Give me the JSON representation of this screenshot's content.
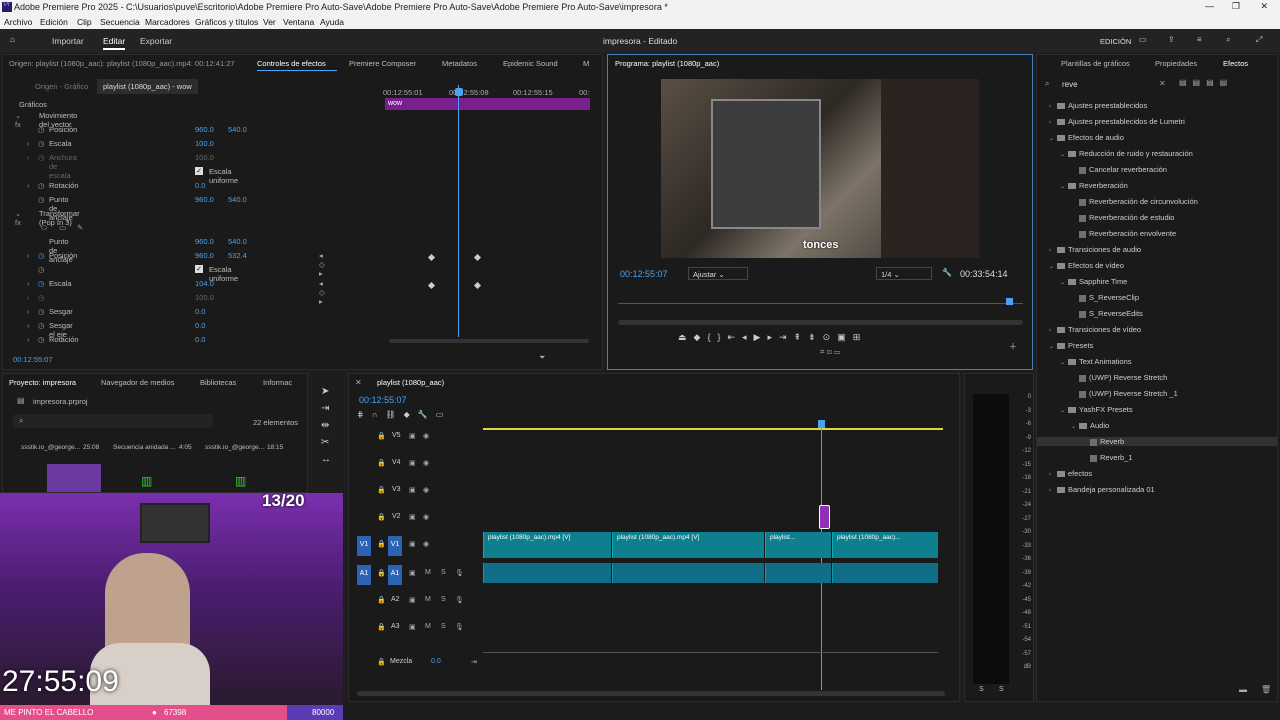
{
  "window": {
    "title": "Adobe Premiere Pro 2025 - C:\\Usuarios\\puve\\Escritorio\\Adobe Premiere Pro Auto-Save\\Adobe Premiere Pro Auto-Save\\Adobe Premiere Pro Auto-Save\\impresora *"
  },
  "menu": [
    "Archivo",
    "Edición",
    "Clip",
    "Secuencia",
    "Marcadores",
    "Gráficos y títulos",
    "Ver",
    "Ventana",
    "Ayuda"
  ],
  "workspace": {
    "import": "Importar",
    "edit": "Editar",
    "export": "Exportar",
    "project_status": "impresora - Editado",
    "mode": "EDICIÓN"
  },
  "effect_controls": {
    "header": "Origen: playlist (1080p_aac): playlist (1080p_aac).mp4: 00:12:41:27",
    "tabs": [
      "Controles de efectos",
      "Premiere Composer",
      "Metadatos",
      "Epidemic Sound",
      "M"
    ],
    "source_tab": "Origen - Gráfico",
    "clip_tab": "playlist (1080p_aac) - wow",
    "times": [
      "00:12:55:01",
      "00:12:55:08",
      "00:12:55:15",
      "00:"
    ],
    "clip_label": "wow",
    "section": "Gráficos",
    "props": [
      {
        "label": "Movimiento del vector",
        "v1": "",
        "v2": ""
      },
      {
        "label": "Posición",
        "v1": "960.0",
        "v2": "540.0"
      },
      {
        "label": "Escala",
        "v1": "100.0",
        "v2": ""
      },
      {
        "label": "Anchura de escala",
        "v1": "100.0",
        "v2": ""
      },
      {
        "label": "Escala uniforme",
        "v1": "",
        "v2": ""
      },
      {
        "label": "Rotación",
        "v1": "0.0",
        "v2": ""
      },
      {
        "label": "Punto de anclaje",
        "v1": "960.0",
        "v2": "540.0"
      },
      {
        "label": "Transformar (Pop In 3)",
        "v1": "",
        "v2": ""
      },
      {
        "label": "",
        "v1": "",
        "v2": ""
      },
      {
        "label": "Punto de anclaje",
        "v1": "960.0",
        "v2": "540.0"
      },
      {
        "label": "Posición",
        "v1": "960.0",
        "v2": "532.4"
      },
      {
        "label": "Escala uniforme",
        "v1": "",
        "v2": ""
      },
      {
        "label": "Escala",
        "v1": "104.0",
        "v2": ""
      },
      {
        "label": "",
        "v1": "100.0",
        "v2": ""
      },
      {
        "label": "Sesgar",
        "v1": "0.0",
        "v2": ""
      },
      {
        "label": "Sesgar el eje",
        "v1": "0.0",
        "v2": ""
      },
      {
        "label": "Rotación",
        "v1": "0.0",
        "v2": ""
      }
    ],
    "timecode": "00:12:55:07"
  },
  "program": {
    "title": "Programa: playlist (1080p_aac)",
    "timecode": "00:12:55:07",
    "fit": "Ajustar",
    "quality": "1/4",
    "duration": "00:33:54:14",
    "caption": "tonces"
  },
  "effects": {
    "tabs": [
      "Plantillas de gráficos",
      "Propiedades",
      "Efectos"
    ],
    "search": "reve",
    "tree": [
      {
        "d": 0,
        "t": "Ajustes preestablecidos",
        "o": false
      },
      {
        "d": 0,
        "t": "Ajustes preestablecidos de Lumetri",
        "o": false
      },
      {
        "d": 0,
        "t": "Efectos de audio",
        "o": true
      },
      {
        "d": 1,
        "t": "Reducción de ruido y restauración",
        "o": true
      },
      {
        "d": 2,
        "t": "Cancelar reverberación",
        "o": null
      },
      {
        "d": 1,
        "t": "Reverberación",
        "o": true
      },
      {
        "d": 2,
        "t": "Reverberación de circunvolución",
        "o": null
      },
      {
        "d": 2,
        "t": "Reverberación de estudio",
        "o": null
      },
      {
        "d": 2,
        "t": "Reverberación envolvente",
        "o": null
      },
      {
        "d": 0,
        "t": "Transiciones de audio",
        "o": false
      },
      {
        "d": 0,
        "t": "Efectos de vídeo",
        "o": true
      },
      {
        "d": 1,
        "t": "Sapphire Time",
        "o": true
      },
      {
        "d": 2,
        "t": "S_ReverseClip",
        "o": null
      },
      {
        "d": 2,
        "t": "S_ReverseEdits",
        "o": null
      },
      {
        "d": 0,
        "t": "Transiciones de vídeo",
        "o": false
      },
      {
        "d": 0,
        "t": "Presets",
        "o": true
      },
      {
        "d": 1,
        "t": "Text Animations",
        "o": true
      },
      {
        "d": 2,
        "t": "(UWP) Reverse Stretch",
        "o": null
      },
      {
        "d": 2,
        "t": "(UWP) Reverse Stretch _1",
        "o": null
      },
      {
        "d": 1,
        "t": "YashFX Presets",
        "o": true
      },
      {
        "d": 2,
        "t": "Audio",
        "o": true
      },
      {
        "d": 3,
        "t": "Reverb",
        "o": null
      },
      {
        "d": 3,
        "t": "Reverb_1",
        "o": null
      },
      {
        "d": 0,
        "t": "efectos",
        "o": false
      },
      {
        "d": 0,
        "t": "Bandeja personalizada 01",
        "o": false
      }
    ]
  },
  "project": {
    "tabs": [
      "Proyecto: impresora",
      "Navegador de medios",
      "Bibliotecas",
      "Informac"
    ],
    "file": "impresora.prproj",
    "count": "22 elementos",
    "items": [
      {
        "name": "ssstik.io_@george...",
        "dur": "25:08"
      },
      {
        "name": "Secuencia anidada ...",
        "dur": "4:05"
      },
      {
        "name": "ssstik.io_@george...",
        "dur": "18:15"
      }
    ]
  },
  "timeline": {
    "tab": "playlist (1080p_aac)",
    "timecode": "00:12:55:07",
    "vtracks": [
      "V5",
      "V4",
      "V3",
      "V2",
      "V1"
    ],
    "atracks": [
      "A1",
      "A2",
      "A3"
    ],
    "mix_label": "Mezcla",
    "mix_val": "0.0",
    "clips": [
      "playlist (1080p_aac).mp4 [V]",
      "playlist (1080p_aac).mp4 [V]",
      "playlist...",
      "playlist (1080p_aac)..."
    ],
    "src_v": "V1",
    "src_a": "A1"
  },
  "meter": {
    "scale": [
      "0",
      "-3",
      "-6",
      "-9",
      "-12",
      "-15",
      "-18",
      "-21",
      "-24",
      "-27",
      "-30",
      "-33",
      "-36",
      "-39",
      "-42",
      "-45",
      "-48",
      "-51",
      "-54",
      "-57",
      "dB"
    ],
    "solo": "S"
  },
  "overlay": {
    "counter": "13/20",
    "clock": "27:55:09",
    "banner": "ME PINTO EL CABELLO",
    "coins": "67398",
    "goal": "80000"
  }
}
